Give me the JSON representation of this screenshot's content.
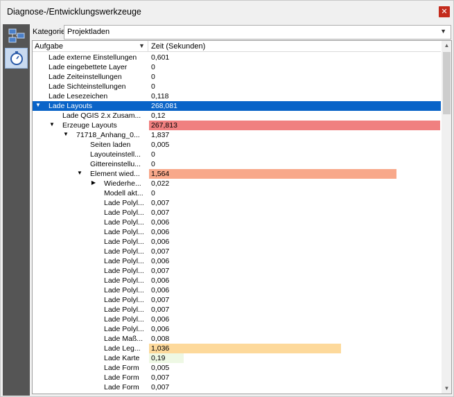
{
  "window": {
    "title": "Diagnose-/Entwicklungswerkzeuge",
    "close_glyph": "✕"
  },
  "sidebar": {
    "items": [
      {
        "icon": "network-icon"
      },
      {
        "icon": "stopwatch-icon"
      }
    ]
  },
  "category": {
    "label": "Kategorie",
    "value": "Projektladen"
  },
  "columns": {
    "task": "Aufgabe",
    "time": "Zeit (Sekunden)"
  },
  "rows": [
    {
      "name": "Lade externe Einstellungen",
      "time": "0,601",
      "depth": 1,
      "toggle": ""
    },
    {
      "name": "Lade eingebettete Layer",
      "time": "0",
      "depth": 1,
      "toggle": ""
    },
    {
      "name": "Lade Zeiteinstellungen",
      "time": "0",
      "depth": 1,
      "toggle": ""
    },
    {
      "name": "Lade Sichteinstellungen",
      "time": "0",
      "depth": 1,
      "toggle": ""
    },
    {
      "name": "Lade Lesezeichen",
      "time": "0,118",
      "depth": 1,
      "toggle": ""
    },
    {
      "name": "Lade Layouts",
      "time": "268,081",
      "depth": 1,
      "toggle": "expanded",
      "selected": true
    },
    {
      "name": "Lade QGIS 2.x Zusam...",
      "time": "0,12",
      "depth": 2,
      "toggle": ""
    },
    {
      "name": "Erzeuge Layouts",
      "time": "267,813",
      "depth": 2,
      "toggle": "expanded",
      "bar": {
        "fraction": 0.999,
        "color": "#f08080"
      }
    },
    {
      "name": "71718_Anhang_0...",
      "time": "1,837",
      "depth": 3,
      "toggle": "expanded"
    },
    {
      "name": "Seiten laden",
      "time": "0,005",
      "depth": 4,
      "toggle": ""
    },
    {
      "name": "Layouteinstell...",
      "time": "0",
      "depth": 4,
      "toggle": ""
    },
    {
      "name": "Gittereinstellu...",
      "time": "0",
      "depth": 4,
      "toggle": ""
    },
    {
      "name": "Element wied...",
      "time": "1,564",
      "depth": 4,
      "toggle": "expanded",
      "bar": {
        "fraction": 0.85,
        "color": "#f8a88a"
      }
    },
    {
      "name": "Wiederhe...",
      "time": "0,022",
      "depth": 5,
      "toggle": "collapsed"
    },
    {
      "name": "Modell akt...",
      "time": "0",
      "depth": 5,
      "toggle": ""
    },
    {
      "name": "Lade Polyl...",
      "time": "0,007",
      "depth": 5,
      "toggle": ""
    },
    {
      "name": "Lade Polyl...",
      "time": "0,007",
      "depth": 5,
      "toggle": ""
    },
    {
      "name": "Lade Polyl...",
      "time": "0,006",
      "depth": 5,
      "toggle": ""
    },
    {
      "name": "Lade Polyl...",
      "time": "0,006",
      "depth": 5,
      "toggle": ""
    },
    {
      "name": "Lade Polyl...",
      "time": "0,006",
      "depth": 5,
      "toggle": ""
    },
    {
      "name": "Lade Polyl...",
      "time": "0,007",
      "depth": 5,
      "toggle": ""
    },
    {
      "name": "Lade Polyl...",
      "time": "0,006",
      "depth": 5,
      "toggle": ""
    },
    {
      "name": "Lade Polyl...",
      "time": "0,007",
      "depth": 5,
      "toggle": ""
    },
    {
      "name": "Lade Polyl...",
      "time": "0,006",
      "depth": 5,
      "toggle": ""
    },
    {
      "name": "Lade Polyl...",
      "time": "0,006",
      "depth": 5,
      "toggle": ""
    },
    {
      "name": "Lade Polyl...",
      "time": "0,007",
      "depth": 5,
      "toggle": ""
    },
    {
      "name": "Lade Polyl...",
      "time": "0,007",
      "depth": 5,
      "toggle": ""
    },
    {
      "name": "Lade Polyl...",
      "time": "0,006",
      "depth": 5,
      "toggle": ""
    },
    {
      "name": "Lade Polyl...",
      "time": "0,006",
      "depth": 5,
      "toggle": ""
    },
    {
      "name": "Lade Maß...",
      "time": "0,008",
      "depth": 5,
      "toggle": ""
    },
    {
      "name": "Lade Leg...",
      "time": "1,036",
      "depth": 5,
      "toggle": "",
      "bar": {
        "fraction": 0.66,
        "color": "#fdd99b"
      }
    },
    {
      "name": "Lade Karte",
      "time": "0,19",
      "depth": 5,
      "toggle": "",
      "bar": {
        "fraction": 0.12,
        "color": "#eef8e4"
      }
    },
    {
      "name": "Lade Form",
      "time": "0,005",
      "depth": 5,
      "toggle": ""
    },
    {
      "name": "Lade Form",
      "time": "0,007",
      "depth": 5,
      "toggle": ""
    },
    {
      "name": "Lade Form",
      "time": "0,007",
      "depth": 5,
      "toggle": ""
    }
  ],
  "scrollbar": {
    "up_glyph": "▲",
    "down_glyph": "▼"
  },
  "colors": {
    "selection": "#0a64c8",
    "sidebar": "#555555"
  }
}
